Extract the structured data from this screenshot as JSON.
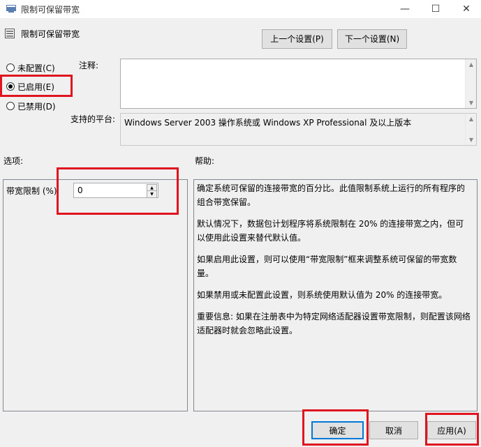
{
  "window": {
    "title": "限制可保留带宽",
    "minimize": "—",
    "maximize": "☐",
    "close": "✕"
  },
  "header": {
    "title": "限制可保留带宽",
    "prev_button": "上一个设置(P)",
    "next_button": "下一个设置(N)"
  },
  "radios": {
    "not_configured": "未配置(C)",
    "enabled": "已启用(E)",
    "disabled": "已禁用(D)",
    "selected": "enabled"
  },
  "comment": {
    "label": "注释:",
    "value": ""
  },
  "platform": {
    "label": "支持的平台:",
    "value": "Windows Server 2003 操作系统或 Windows XP Professional 及以上版本"
  },
  "options": {
    "label": "选项:",
    "bandwidth_label": "带宽限制 (%)",
    "bandwidth_value": "0"
  },
  "help": {
    "label": "帮助:",
    "paragraphs": [
      "确定系统可保留的连接带宽的百分比。此值限制系统上运行的所有程序的组合带宽保留。",
      "默认情况下，数据包计划程序将系统限制在 20% 的连接带宽之内，但可以使用此设置来替代默认值。",
      "如果启用此设置，则可以使用“带宽限制”框来调整系统可保留的带宽数量。",
      "如果禁用或未配置此设置，则系统使用默认值为 20% 的连接带宽。",
      "重要信息: 如果在注册表中为特定网络适配器设置带宽限制，则配置该网络适配器时就会忽略此设置。"
    ]
  },
  "footer": {
    "ok": "确定",
    "cancel": "取消",
    "apply": "应用(A)"
  },
  "colors": {
    "highlight": "#e0141e",
    "window_bg": "#f0f0f0"
  }
}
